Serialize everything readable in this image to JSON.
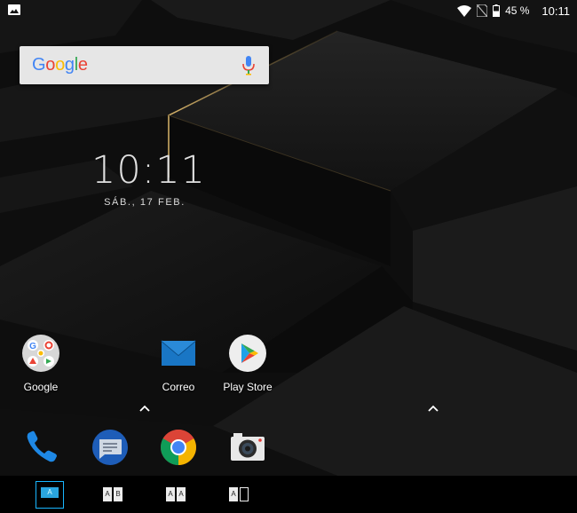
{
  "status_bar": {
    "battery_text": "45 %",
    "time": "10:11"
  },
  "search": {
    "logo_letters": [
      "G",
      "o",
      "o",
      "g",
      "l",
      "e"
    ],
    "logo_colors": [
      "#4285F4",
      "#EA4335",
      "#FBBC05",
      "#4285F4",
      "#34A853",
      "#EA4335"
    ]
  },
  "clock_widget": {
    "time": "10:11",
    "date": "SÁB., 17 FEB."
  },
  "apps": {
    "google_label": "Google",
    "correo_label": "Correo",
    "playstore_label": "Play Store"
  },
  "layout_buttons": [
    {
      "cells": [
        "A"
      ],
      "active": true
    },
    {
      "cells": [
        "A",
        "B"
      ],
      "active": false
    },
    {
      "cells": [
        "A",
        "A"
      ],
      "active": false
    },
    {
      "cells": [
        "A",
        ""
      ],
      "active": false
    }
  ],
  "colors": {
    "accent": "#19b6ff",
    "wallpaper_edge": "#c7a25a"
  }
}
